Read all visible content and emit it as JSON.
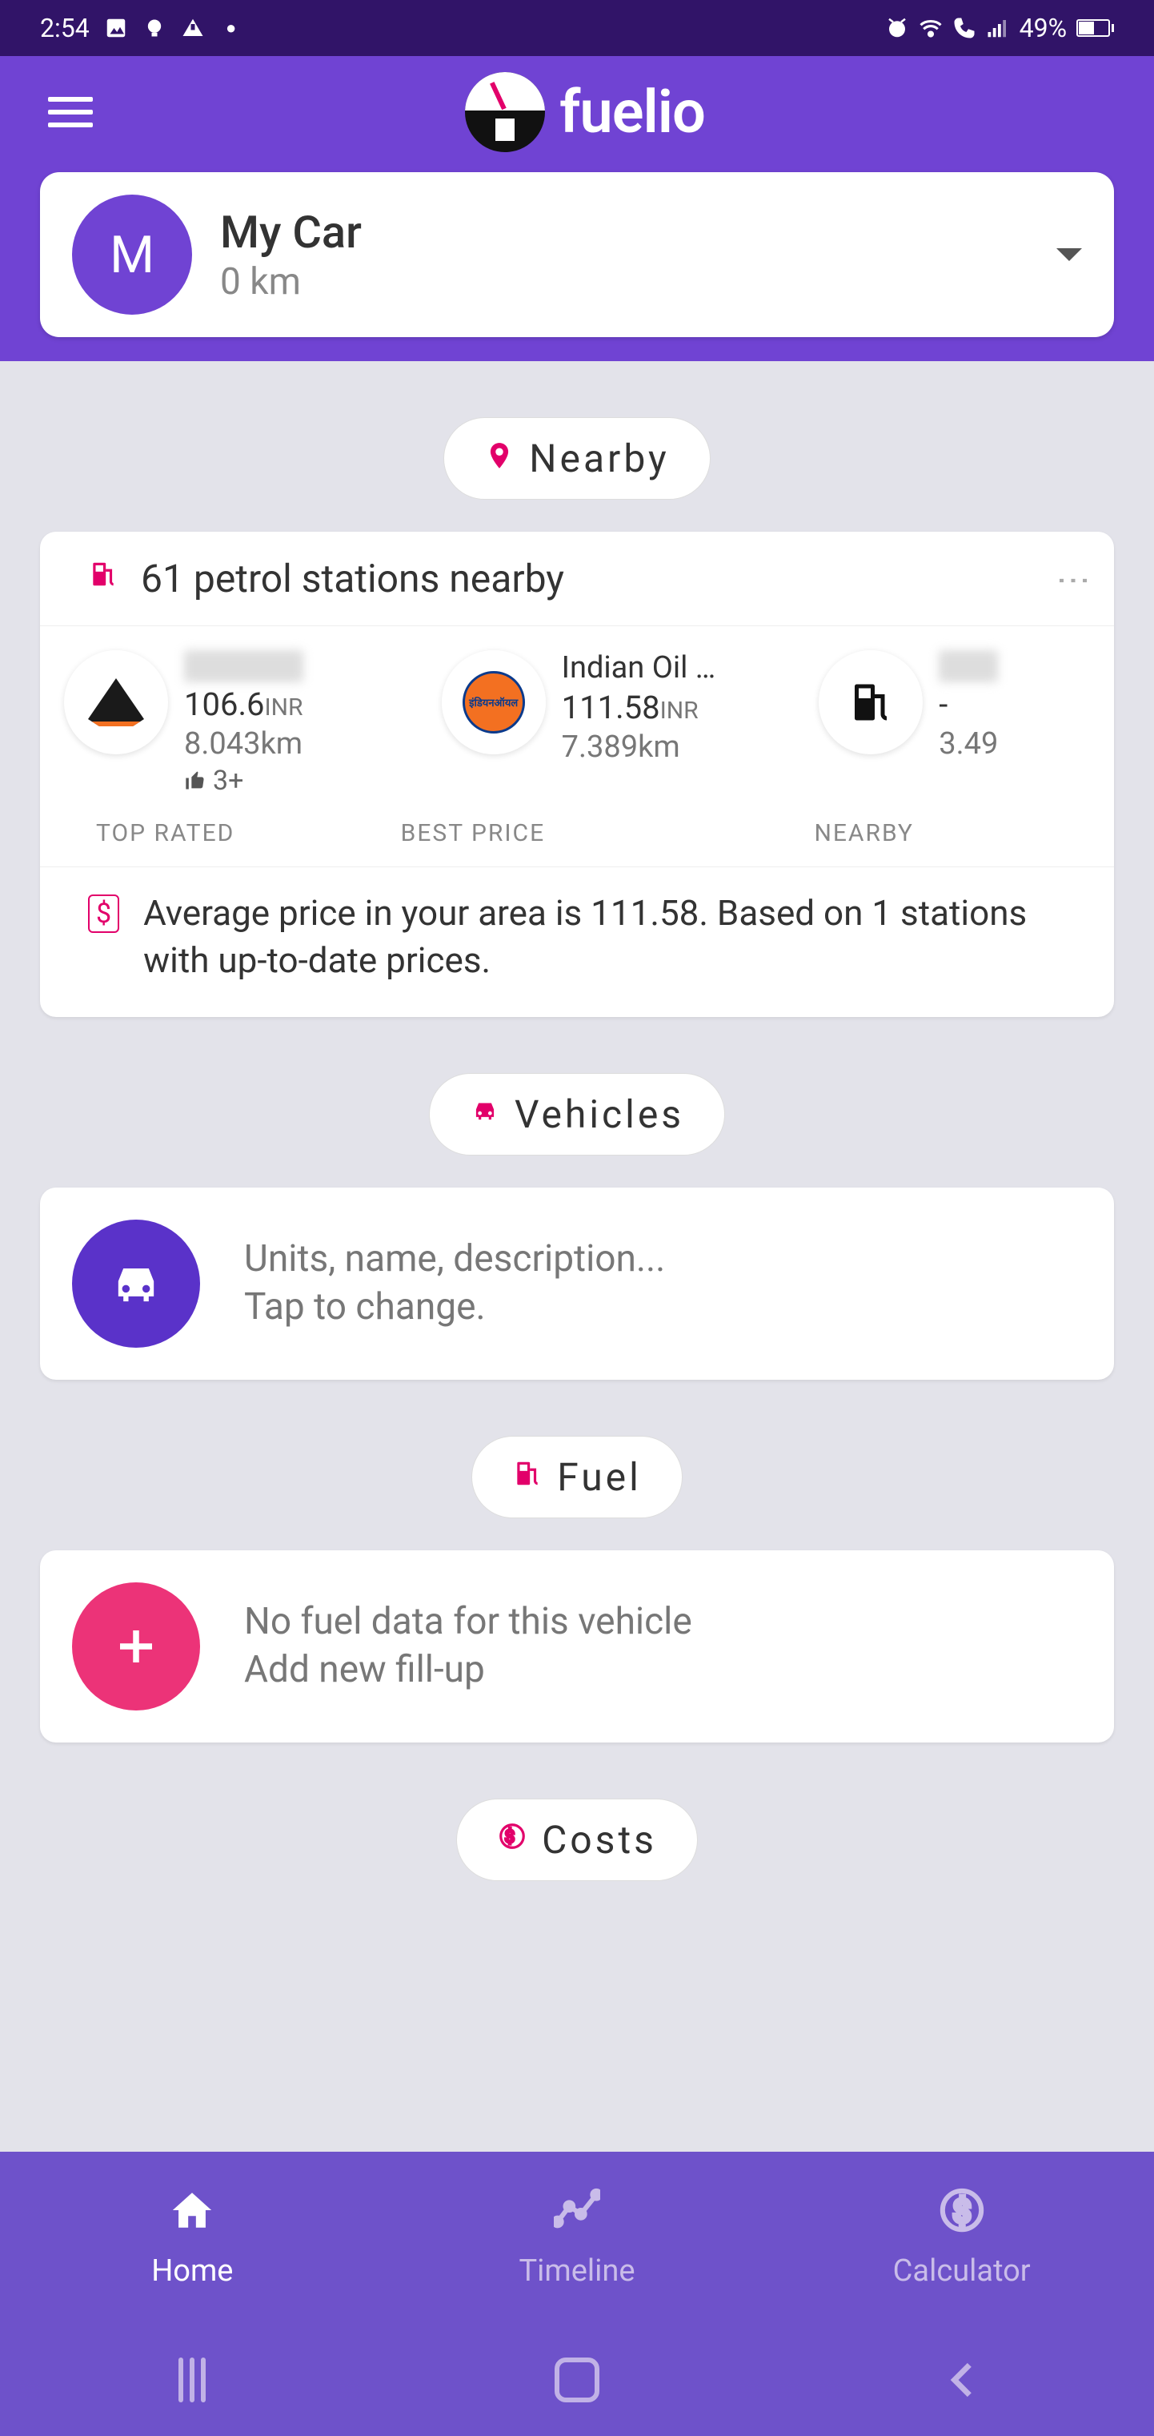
{
  "status": {
    "time": "2:54",
    "battery_pct": "49%"
  },
  "app": {
    "title": "fuelio"
  },
  "car": {
    "avatar_letter": "M",
    "name": "My Car",
    "subtitle": "0 km"
  },
  "sections": {
    "nearby_label": "Nearby",
    "vehicles_label": "Vehicles",
    "fuel_label": "Fuel",
    "costs_label": "Costs"
  },
  "nearby": {
    "title": "61 petrol stations nearby",
    "stations": [
      {
        "name": "",
        "price": "106.6",
        "currency": "INR",
        "distance": "8.043km",
        "likes": "3+",
        "tag": "TOP RATED"
      },
      {
        "name": "Indian Oil …",
        "price": "111.58",
        "currency": "INR",
        "distance": "7.389km",
        "tag": "BEST PRICE"
      },
      {
        "name": "",
        "price": "-",
        "currency": "",
        "distance": "3.49",
        "tag": "NEARBY"
      }
    ],
    "footer": "Average price in your area is 111.58. Based on 1 stations with up-to-date prices."
  },
  "vehicles_card": {
    "line1": "Units, name, description...",
    "line2": "Tap to change."
  },
  "fuel_card": {
    "line1": "No fuel data for this vehicle",
    "line2": "Add new fill-up"
  },
  "bottom_nav": {
    "home": "Home",
    "timeline": "Timeline",
    "calculator": "Calculator"
  }
}
